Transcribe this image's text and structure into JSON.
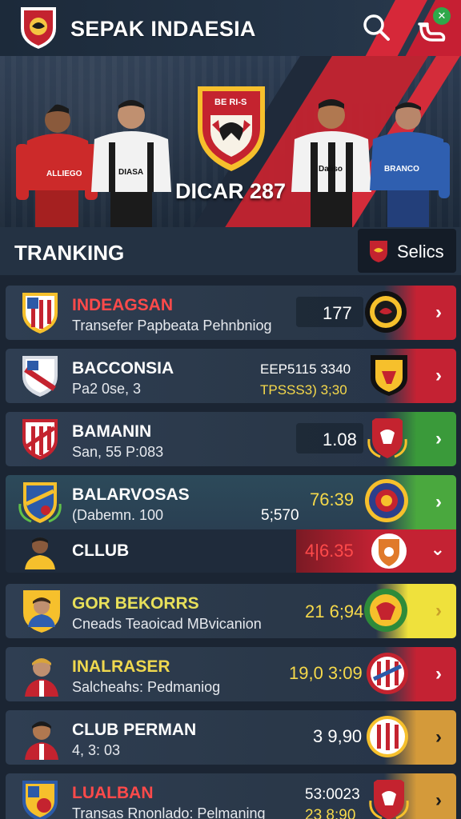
{
  "header": {
    "title": "SEPAK INDAESIA",
    "notification_badge": "✕",
    "crest_text": "",
    "accent": "#d62839"
  },
  "hero": {
    "crest_text": "BE RI-S",
    "title": "DICAR 287",
    "player_jerseys": [
      "ALLIEGO",
      "DIASA",
      "Daliso",
      "BRANCO"
    ]
  },
  "section": {
    "title": "TRANKING",
    "select_label": "Selics"
  },
  "rows": [
    {
      "name": "INDEAGSAN",
      "sub": "Transefer Papbeata Pehnbniog",
      "value": "177",
      "value2": "",
      "name_color": "#ff4a4a",
      "tail": "#c42233"
    },
    {
      "name": "BACCONSIA",
      "sub": "Pa2 0se, 3",
      "value": "EEP5115 3340",
      "value2": "TPSSS3) 3;30",
      "name_color": "#ffffff",
      "tail": "#c42233"
    },
    {
      "name": "BAMANIN",
      "sub": "San, 55 P:083",
      "value": "1.08",
      "value2": "",
      "name_color": "#ffffff",
      "tail": "#3a9a3a"
    },
    {
      "name": "BALARVOSAS",
      "sub": "(Dabemn. 100",
      "value": "76:39",
      "value2": "5;570",
      "name_color": "#ffffff",
      "tail": "#4aa83e"
    },
    {
      "name": "CLLUB",
      "sub": "",
      "value": "4|6.35",
      "value2": "",
      "name_color": "#ffffff",
      "tail": "#c42233"
    },
    {
      "name": "GOR BEKORRS",
      "sub": "Cneads Teaoicad MBvicanion",
      "value": "21 6;94",
      "value2": "",
      "name_color": "#e8e05a",
      "tail": "#efe13c"
    },
    {
      "name": "INALRASER",
      "sub": "Salcheahs: Pedmaniog",
      "value": "19,0 3:09",
      "value2": "",
      "name_color": "#efd84e",
      "tail": "#c42233"
    },
    {
      "name": "CLUB PERMAN",
      "sub": "4, 3: 03",
      "value": "3 9,90",
      "value2": "",
      "name_color": "#ffffff",
      "tail": "#d49a3a"
    },
    {
      "name": "LUALBAN",
      "sub": "Transas Rnonlado: Pelmaning",
      "value": "53:0023",
      "value2": "23 8:90",
      "name_color": "#ff4a4a",
      "tail": "#d49a3a"
    }
  ]
}
